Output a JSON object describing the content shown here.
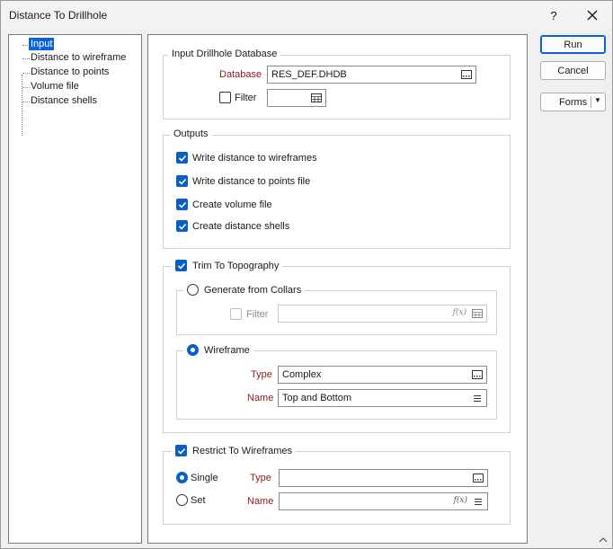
{
  "window": {
    "title": "Distance To Drillhole",
    "help_label": "?",
    "close_label": "✕"
  },
  "tree": {
    "items": [
      {
        "label": "Input",
        "selected": true
      },
      {
        "label": "Distance to wireframe"
      },
      {
        "label": "Distance to points"
      },
      {
        "label": "Volume file"
      },
      {
        "label": "Distance shells"
      }
    ]
  },
  "input_group": {
    "title": "Input Drillhole Database",
    "database_label": "Database",
    "database_value": "RES_DEF.DHDB",
    "filter_label": "Filter",
    "filter_value": ""
  },
  "outputs": {
    "title": "Outputs",
    "items": [
      {
        "label": "Write distance to wireframes",
        "checked": true
      },
      {
        "label": "Write distance to points file",
        "checked": true
      },
      {
        "label": "Create volume file",
        "checked": true
      },
      {
        "label": "Create distance shells",
        "checked": true
      }
    ]
  },
  "trim": {
    "title": "Trim To Topography",
    "checked": true,
    "collars": {
      "title": "Generate from Collars",
      "filter_label": "Filter",
      "filter_value": "",
      "fx_label": "f(x)"
    },
    "wireframe": {
      "title": "Wireframe",
      "type_label": "Type",
      "type_value": "Complex",
      "name_label": "Name",
      "name_value": "Top and Bottom"
    }
  },
  "restrict": {
    "title": "Restrict To Wireframes",
    "checked": true,
    "single_label": "Single",
    "set_label": "Set",
    "type_label": "Type",
    "type_value": "",
    "name_label": "Name",
    "name_value": "",
    "fx_label": "f(x)"
  },
  "buttons": {
    "run": "Run",
    "cancel": "Cancel",
    "forms": "Forms",
    "forms_arrow": "▼"
  },
  "colors": {
    "accent": "#0a5fc4",
    "selection": "#0a64d6",
    "label_red": "#8b1a1a"
  }
}
